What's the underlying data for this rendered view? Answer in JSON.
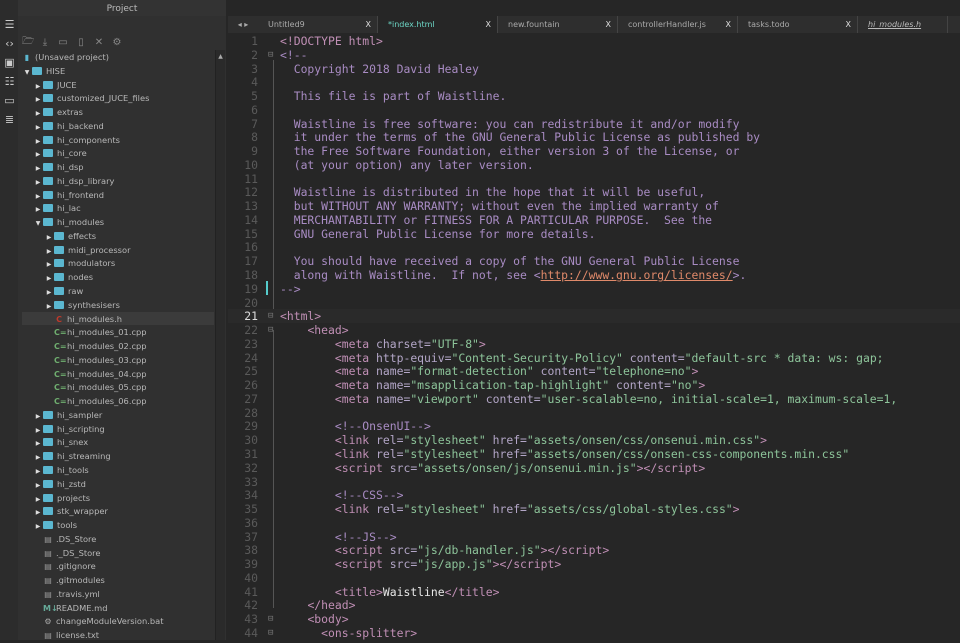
{
  "panel": {
    "title": "Project"
  },
  "tree": [
    {
      "label": "(Unsaved project)",
      "depth": 0,
      "type": "proj"
    },
    {
      "label": "HISE",
      "depth": 0,
      "type": "open"
    },
    {
      "label": "JUCE",
      "depth": 1,
      "type": "closed"
    },
    {
      "label": "customized_JUCE_files",
      "depth": 1,
      "type": "closed"
    },
    {
      "label": "extras",
      "depth": 1,
      "type": "closed"
    },
    {
      "label": "hi_backend",
      "depth": 1,
      "type": "closed"
    },
    {
      "label": "hi_components",
      "depth": 1,
      "type": "closed"
    },
    {
      "label": "hi_core",
      "depth": 1,
      "type": "closed"
    },
    {
      "label": "hi_dsp",
      "depth": 1,
      "type": "closed"
    },
    {
      "label": "hi_dsp_library",
      "depth": 1,
      "type": "closed"
    },
    {
      "label": "hi_frontend",
      "depth": 1,
      "type": "closed"
    },
    {
      "label": "hi_lac",
      "depth": 1,
      "type": "closed"
    },
    {
      "label": "hi_modules",
      "depth": 1,
      "type": "open"
    },
    {
      "label": "effects",
      "depth": 2,
      "type": "closed"
    },
    {
      "label": "midi_processor",
      "depth": 2,
      "type": "closed"
    },
    {
      "label": "modulators",
      "depth": 2,
      "type": "closed"
    },
    {
      "label": "nodes",
      "depth": 2,
      "type": "closed"
    },
    {
      "label": "raw",
      "depth": 2,
      "type": "closed"
    },
    {
      "label": "synthesisers",
      "depth": 2,
      "type": "closed"
    },
    {
      "label": "hi_modules.h",
      "depth": 2,
      "type": "h",
      "selected": true
    },
    {
      "label": "hi_modules_01.cpp",
      "depth": 2,
      "type": "cpp"
    },
    {
      "label": "hi_modules_02.cpp",
      "depth": 2,
      "type": "cpp"
    },
    {
      "label": "hi_modules_03.cpp",
      "depth": 2,
      "type": "cpp"
    },
    {
      "label": "hi_modules_04.cpp",
      "depth": 2,
      "type": "cpp"
    },
    {
      "label": "hi_modules_05.cpp",
      "depth": 2,
      "type": "cpp"
    },
    {
      "label": "hi_modules_06.cpp",
      "depth": 2,
      "type": "cpp"
    },
    {
      "label": "hi_sampler",
      "depth": 1,
      "type": "closed"
    },
    {
      "label": "hi_scripting",
      "depth": 1,
      "type": "closed"
    },
    {
      "label": "hi_snex",
      "depth": 1,
      "type": "closed"
    },
    {
      "label": "hi_streaming",
      "depth": 1,
      "type": "closed"
    },
    {
      "label": "hi_tools",
      "depth": 1,
      "type": "closed"
    },
    {
      "label": "hi_zstd",
      "depth": 1,
      "type": "closed"
    },
    {
      "label": "projects",
      "depth": 1,
      "type": "closed"
    },
    {
      "label": "stk_wrapper",
      "depth": 1,
      "type": "closed"
    },
    {
      "label": "tools",
      "depth": 1,
      "type": "closed"
    },
    {
      "label": ".DS_Store",
      "depth": 1,
      "type": "doc"
    },
    {
      "label": "._DS_Store",
      "depth": 1,
      "type": "doc"
    },
    {
      "label": ".gitignore",
      "depth": 1,
      "type": "doc"
    },
    {
      "label": ".gitmodules",
      "depth": 1,
      "type": "doc"
    },
    {
      "label": ".travis.yml",
      "depth": 1,
      "type": "doc"
    },
    {
      "label": "README.md",
      "depth": 1,
      "type": "md"
    },
    {
      "label": "changeModuleVersion.bat",
      "depth": 1,
      "type": "bat"
    },
    {
      "label": "license.txt",
      "depth": 1,
      "type": "doc"
    }
  ],
  "tabs": [
    {
      "label": "Untitled9",
      "width": 120
    },
    {
      "label": "*index.html",
      "width": 120,
      "active": true
    },
    {
      "label": "new.fountain",
      "width": 120
    },
    {
      "label": "controllerHandler.js",
      "width": 120
    },
    {
      "label": "tasks.todo",
      "width": 120
    },
    {
      "label": "hi_modules.h",
      "width": 90,
      "italic": true
    }
  ],
  "tab_close": "X",
  "current_line": 21,
  "code": [
    [
      1,
      "",
      [
        [
          "t",
          "<!DOCTYPE html>"
        ]
      ]
    ],
    [
      2,
      "⊟",
      [
        [
          "c",
          "<!--"
        ]
      ]
    ],
    [
      3,
      "",
      [
        [
          "c",
          "  Copyright 2018 David Healey"
        ]
      ]
    ],
    [
      4,
      "",
      []
    ],
    [
      5,
      "",
      [
        [
          "c",
          "  This file is part of Waistline."
        ]
      ]
    ],
    [
      6,
      "",
      []
    ],
    [
      7,
      "",
      [
        [
          "c",
          "  Waistline is free software: you can redistribute it and/or modify"
        ]
      ]
    ],
    [
      8,
      "",
      [
        [
          "c",
          "  it under the terms of the GNU General Public License as published by"
        ]
      ]
    ],
    [
      9,
      "",
      [
        [
          "c",
          "  the Free Software Foundation, either version 3 of the License, or"
        ]
      ]
    ],
    [
      10,
      "",
      [
        [
          "c",
          "  (at your option) any later version."
        ]
      ]
    ],
    [
      11,
      "",
      []
    ],
    [
      12,
      "",
      [
        [
          "c",
          "  Waistline is distributed in the hope that it will be useful,"
        ]
      ]
    ],
    [
      13,
      "",
      [
        [
          "c",
          "  but WITHOUT ANY WARRANTY; without even the implied warranty of"
        ]
      ]
    ],
    [
      14,
      "",
      [
        [
          "c",
          "  MERCHANTABILITY or FITNESS FOR A PARTICULAR PURPOSE.  See the"
        ]
      ]
    ],
    [
      15,
      "",
      [
        [
          "c",
          "  GNU General Public License for more details."
        ]
      ]
    ],
    [
      16,
      "",
      []
    ],
    [
      17,
      "",
      [
        [
          "c",
          "  You should have received a copy of the GNU General Public License"
        ]
      ]
    ],
    [
      18,
      "",
      [
        [
          "c",
          "  along with Waistline.  If not, see <"
        ],
        [
          "u",
          "http://www.gnu.org/licenses/"
        ],
        [
          "c",
          ">."
        ]
      ]
    ],
    [
      19,
      "",
      [
        [
          "c",
          "-->"
        ]
      ]
    ],
    [
      20,
      "",
      []
    ],
    [
      21,
      "⊟",
      [
        [
          "t",
          "<html>"
        ]
      ]
    ],
    [
      22,
      "⊟",
      [
        [
          "x",
          "    "
        ],
        [
          "t",
          "<head>"
        ]
      ]
    ],
    [
      23,
      "",
      [
        [
          "x",
          "        "
        ],
        [
          "t",
          "<meta "
        ],
        [
          "a",
          "charset="
        ],
        [
          "s",
          "\"UTF-8\""
        ],
        [
          "t",
          ">"
        ]
      ]
    ],
    [
      24,
      "",
      [
        [
          "x",
          "        "
        ],
        [
          "t",
          "<meta "
        ],
        [
          "a",
          "http-equiv="
        ],
        [
          "s",
          "\"Content-Security-Policy\""
        ],
        [
          "a",
          " content="
        ],
        [
          "s",
          "\"default-src * data: ws: gap;"
        ]
      ]
    ],
    [
      25,
      "",
      [
        [
          "x",
          "        "
        ],
        [
          "t",
          "<meta "
        ],
        [
          "a",
          "name="
        ],
        [
          "s",
          "\"format-detection\""
        ],
        [
          "a",
          " content="
        ],
        [
          "s",
          "\"telephone=no\""
        ],
        [
          "t",
          ">"
        ]
      ]
    ],
    [
      26,
      "",
      [
        [
          "x",
          "        "
        ],
        [
          "t",
          "<meta "
        ],
        [
          "a",
          "name="
        ],
        [
          "s",
          "\"msapplication-tap-highlight\""
        ],
        [
          "a",
          " content="
        ],
        [
          "s",
          "\"no\""
        ],
        [
          "t",
          ">"
        ]
      ]
    ],
    [
      27,
      "",
      [
        [
          "x",
          "        "
        ],
        [
          "t",
          "<meta "
        ],
        [
          "a",
          "name="
        ],
        [
          "s",
          "\"viewport\""
        ],
        [
          "a",
          " content="
        ],
        [
          "s",
          "\"user-scalable=no, initial-scale=1, maximum-scale=1,"
        ]
      ]
    ],
    [
      28,
      "",
      []
    ],
    [
      29,
      "",
      [
        [
          "x",
          "        "
        ],
        [
          "c",
          "<!--OnsenUI-->"
        ]
      ]
    ],
    [
      30,
      "",
      [
        [
          "x",
          "        "
        ],
        [
          "t",
          "<link "
        ],
        [
          "a",
          "rel="
        ],
        [
          "s",
          "\"stylesheet\""
        ],
        [
          "a",
          " href="
        ],
        [
          "s",
          "\"assets/onsen/css/onsenui.min.css\""
        ],
        [
          "t",
          ">"
        ]
      ]
    ],
    [
      31,
      "",
      [
        [
          "x",
          "        "
        ],
        [
          "t",
          "<link "
        ],
        [
          "a",
          "rel="
        ],
        [
          "s",
          "\"stylesheet\""
        ],
        [
          "a",
          " href="
        ],
        [
          "s",
          "\"assets/onsen/css/onsen-css-components.min.css\""
        ]
      ]
    ],
    [
      32,
      "",
      [
        [
          "x",
          "        "
        ],
        [
          "t",
          "<script "
        ],
        [
          "a",
          "src="
        ],
        [
          "s",
          "\"assets/onsen/js/onsenui.min.js\""
        ],
        [
          "t",
          "></script>"
        ]
      ]
    ],
    [
      33,
      "",
      []
    ],
    [
      34,
      "",
      [
        [
          "x",
          "        "
        ],
        [
          "c",
          "<!--CSS-->"
        ]
      ]
    ],
    [
      35,
      "",
      [
        [
          "x",
          "        "
        ],
        [
          "t",
          "<link "
        ],
        [
          "a",
          "rel="
        ],
        [
          "s",
          "\"stylesheet\""
        ],
        [
          "a",
          " href="
        ],
        [
          "s",
          "\"assets/css/global-styles.css\""
        ],
        [
          "t",
          ">"
        ]
      ]
    ],
    [
      36,
      "",
      []
    ],
    [
      37,
      "",
      [
        [
          "x",
          "        "
        ],
        [
          "c",
          "<!--JS-->"
        ]
      ]
    ],
    [
      38,
      "",
      [
        [
          "x",
          "        "
        ],
        [
          "t",
          "<script "
        ],
        [
          "a",
          "src="
        ],
        [
          "s",
          "\"js/db-handler.js\""
        ],
        [
          "t",
          "></script>"
        ]
      ]
    ],
    [
      39,
      "",
      [
        [
          "x",
          "        "
        ],
        [
          "t",
          "<script "
        ],
        [
          "a",
          "src="
        ],
        [
          "s",
          "\"js/app.js\""
        ],
        [
          "t",
          "></script>"
        ]
      ]
    ],
    [
      40,
      "",
      []
    ],
    [
      41,
      "",
      [
        [
          "x",
          "        "
        ],
        [
          "t",
          "<title>"
        ],
        [
          "x",
          "Waistline"
        ],
        [
          "t",
          "</title>"
        ]
      ]
    ],
    [
      42,
      "",
      [
        [
          "x",
          "    "
        ],
        [
          "t",
          "</head>"
        ]
      ]
    ],
    [
      43,
      "⊟",
      [
        [
          "x",
          "    "
        ],
        [
          "t",
          "<body>"
        ]
      ]
    ],
    [
      44,
      "⊟",
      [
        [
          "x",
          "      "
        ],
        [
          "t",
          "<ons-splitter>"
        ]
      ]
    ]
  ]
}
